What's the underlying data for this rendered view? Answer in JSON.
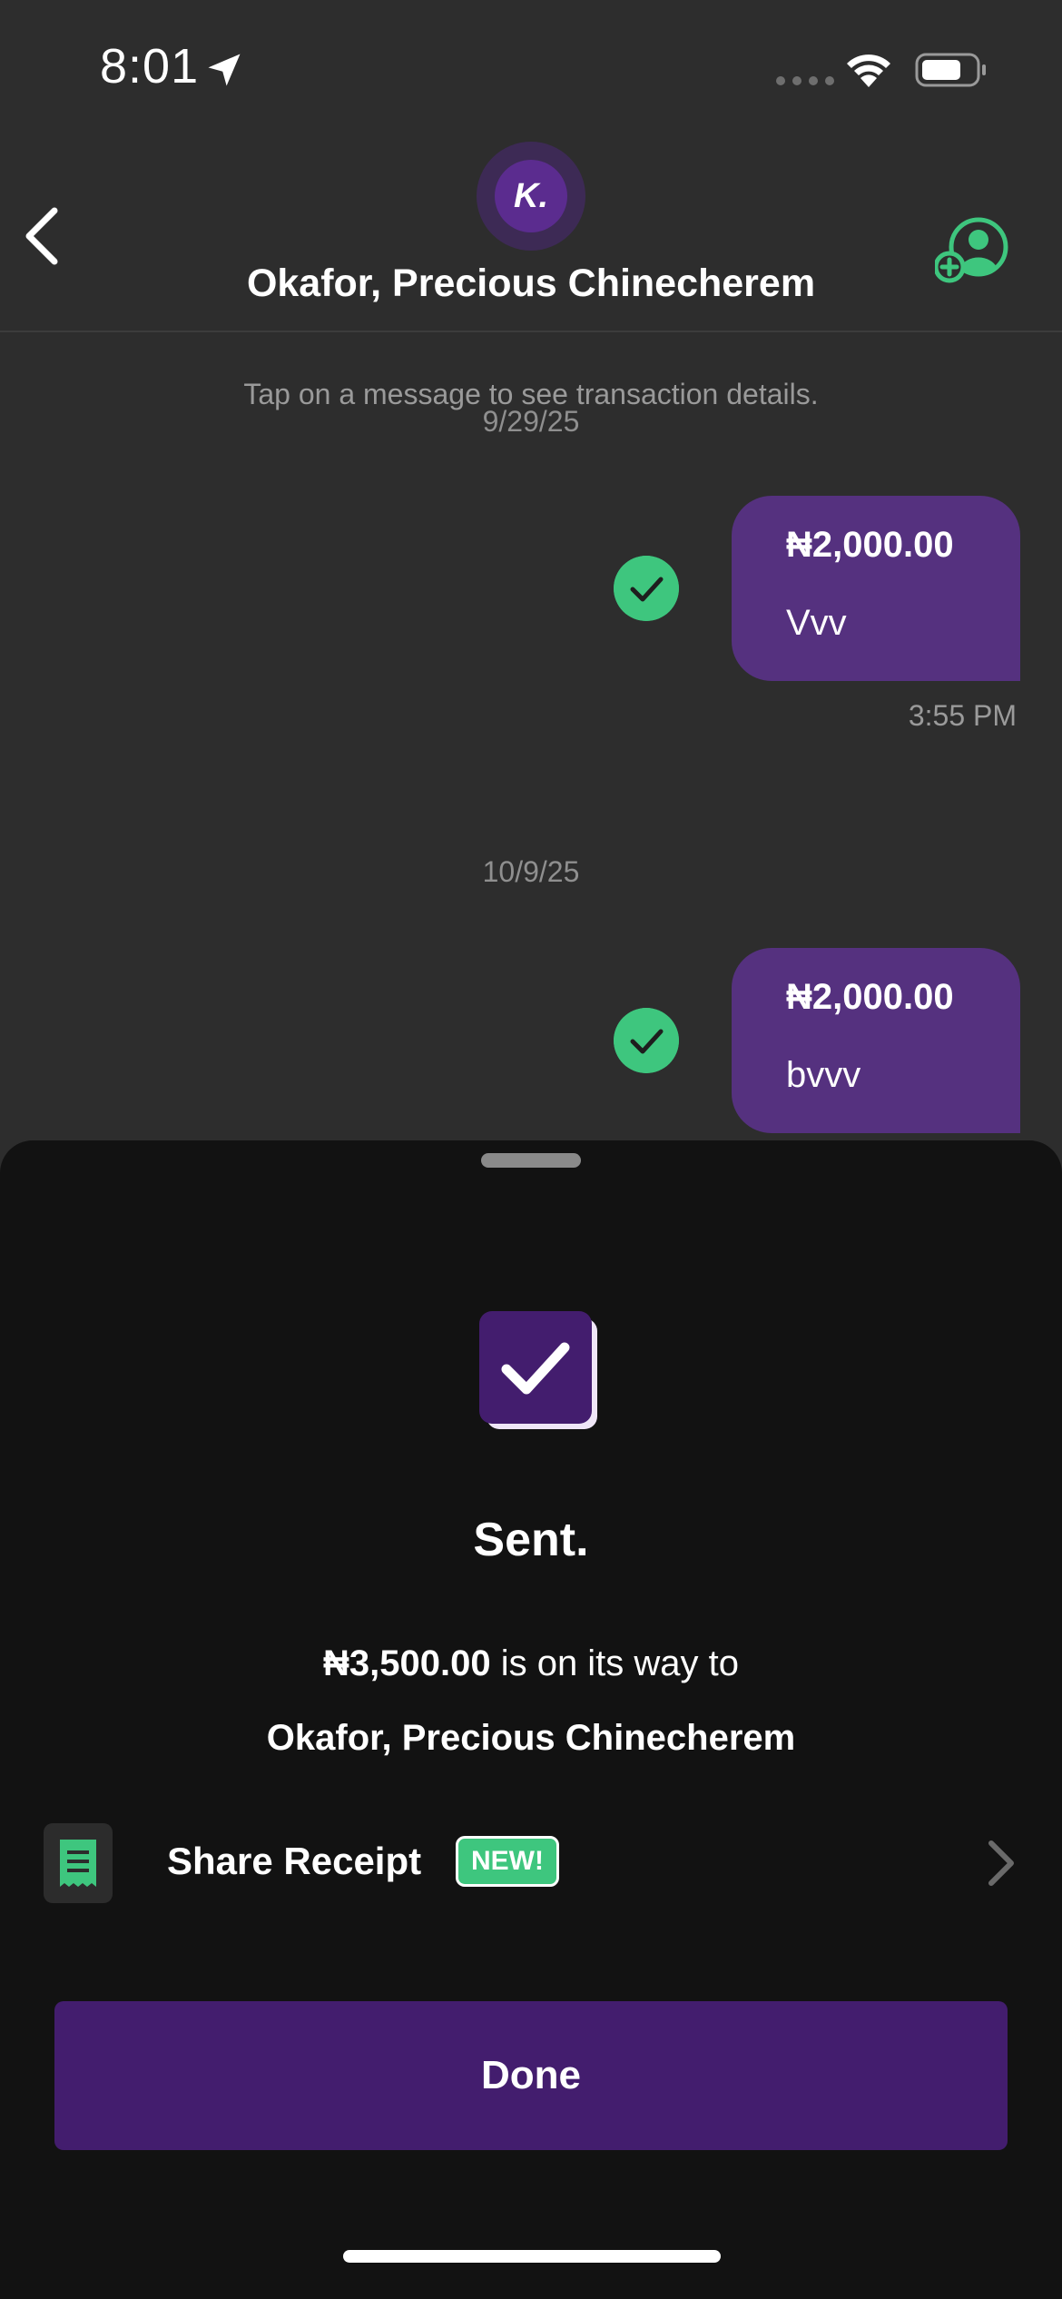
{
  "status_bar": {
    "time": "8:01",
    "icons": [
      "location-arrow-icon",
      "cellular-signal-icon",
      "wifi-icon",
      "battery-icon"
    ]
  },
  "header": {
    "avatar_letter": "K.",
    "contact_name": "Okafor, Precious Chinecherem",
    "icons": [
      "back-chevron-icon",
      "add-contact-icon"
    ]
  },
  "chat": {
    "hint": "Tap on a message to see transaction details.",
    "groups": [
      {
        "date": "9/29/25",
        "amount": "₦2,000.00",
        "note": "Vvv",
        "time": "3:55 PM"
      },
      {
        "date": "10/9/25",
        "amount": "₦2,000.00",
        "note": "bvvv"
      }
    ]
  },
  "sheet": {
    "title": "Sent.",
    "amount": "₦3,500.00",
    "message_suffix": " is on its way to",
    "recipient": "Okafor, Precious Chinecherem",
    "share_receipt_label": "Share Receipt",
    "new_badge": "NEW!",
    "done_label": "Done"
  },
  "colors": {
    "background": "#2d2d2d",
    "sheet": "#121212",
    "bubble": "#55317f",
    "accent_green": "#3ec67e",
    "button_purple": "#431d6e"
  }
}
